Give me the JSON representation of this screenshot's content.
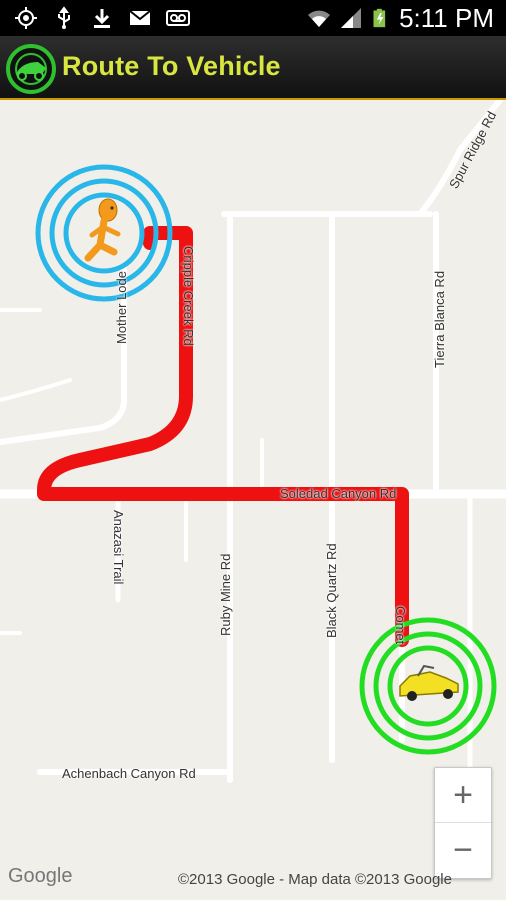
{
  "status_bar": {
    "time": "5:11 PM",
    "left_icons": [
      "gps-icon",
      "usb-icon",
      "download-icon",
      "gmail-icon",
      "voicemail-icon"
    ],
    "right_icons": [
      "wifi-icon",
      "signal-icon",
      "battery-charging-icon"
    ]
  },
  "app_bar": {
    "title": "Route To Vehicle",
    "logo_icon": "car-pointer-logo-icon",
    "title_color": "#d9e640"
  },
  "map": {
    "road_labels": {
      "spur_ridge": "Spur Ridge Rd",
      "mother_lode": "Mother Lode",
      "cripple_creek": "Cripple Creek Rd",
      "tierra_blanca": "Tierra Blanca Rd",
      "soledad_canyon": "Soledad Canyon Rd",
      "anazasi_trail": "Anazasi Trail",
      "ruby_mine": "Ruby Mine Rd",
      "black_quartz": "Black Quartz Rd",
      "comet": "Comet",
      "achenbach_canyon": "Achenbach Canyon Rd"
    },
    "user_marker_icon": "walking-person-icon",
    "vehicle_marker_icon": "yellow-car-icon",
    "route_color": "#ee1111",
    "user_ring_color": "#29b6e8",
    "vehicle_ring_color": "#22dd22",
    "zoom_in_label": "+",
    "zoom_out_label": "−",
    "attribution_logo": "Google",
    "copyright": "©2013 Google - Map data ©2013 Google"
  }
}
